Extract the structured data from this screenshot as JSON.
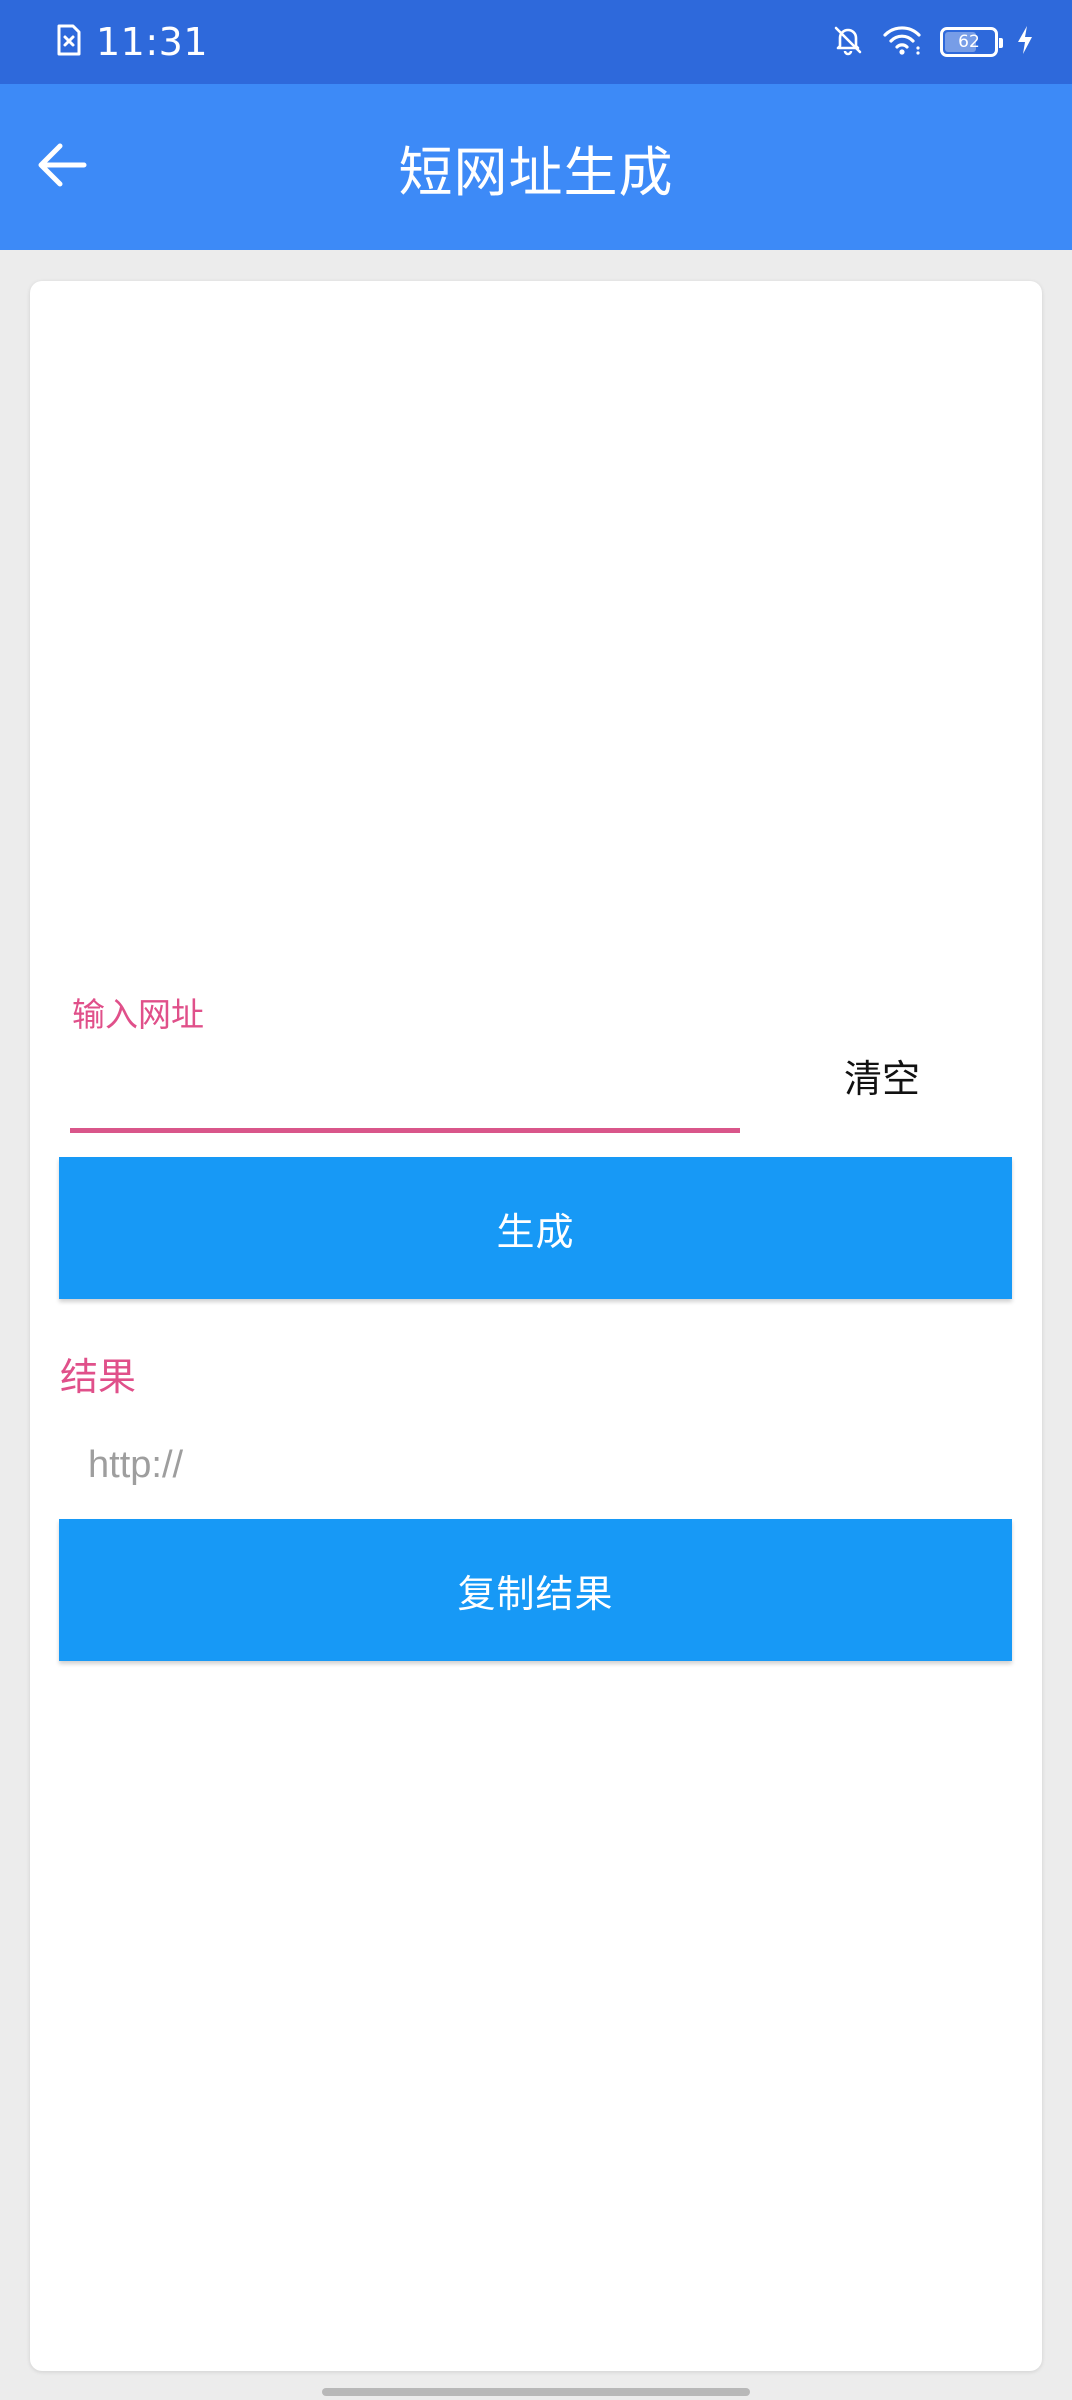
{
  "status_bar": {
    "time": "11:31",
    "battery_level": "62",
    "icons": [
      "file-x-icon",
      "bell-off-icon",
      "wifi-icon",
      "battery-icon",
      "charging-bolt-icon"
    ]
  },
  "app_bar": {
    "title": "短网址生成",
    "back_icon": "arrow-left-icon"
  },
  "form": {
    "input_label": "输入网址",
    "input_value": "",
    "clear_label": "清空",
    "generate_label": "生成",
    "result_label": "结果",
    "result_placeholder": "http://",
    "result_value": "",
    "copy_label": "复制结果"
  },
  "colors": {
    "status_bar": "#2E69DB",
    "app_bar": "#3D8AF7",
    "button": "#1799F6",
    "accent_pink": "#E0508A",
    "background": "#ECECEC"
  }
}
